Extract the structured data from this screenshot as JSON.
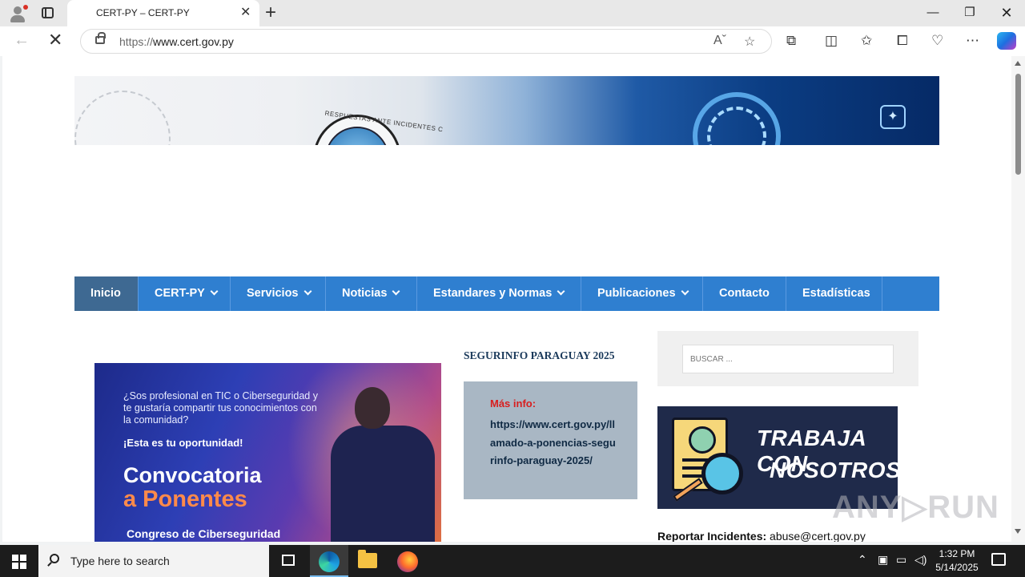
{
  "browser": {
    "tab_title": "CERT-PY – CERT-PY",
    "url_scheme": "https://",
    "url_host": "www.cert.gov.py",
    "tab_close_glyph": "✕",
    "new_tab_glyph": "+",
    "minimize_glyph": "—",
    "maximize_glyph": "❐",
    "close_glyph": "✕",
    "back_glyph": "←",
    "stop_glyph": "✕"
  },
  "site": {
    "banner_arc_text": "RESPUESTAS ANTE INCIDENTES C",
    "nav": [
      {
        "label": "Inicio",
        "active": true
      },
      {
        "label": "CERT-PY",
        "dropdown": true
      },
      {
        "label": "Servicios",
        "dropdown": true
      },
      {
        "label": "Noticias",
        "dropdown": true
      },
      {
        "label": "Estandares y Normas",
        "dropdown": true
      },
      {
        "label": "Publicaciones",
        "dropdown": true
      },
      {
        "label": "Contacto"
      },
      {
        "label": "Estadísticas"
      }
    ],
    "promo": {
      "question": "¿Sos profesional en TIC o Ciberseguridad y te gustaría compartir tus conocimientos con la comunidad?",
      "opportunity": "¡Esta es tu oportunidad!",
      "headline_1": "Convocatoria",
      "headline_2": "a Ponentes",
      "subtitle": "Congreso de Ciberseguridad"
    },
    "event_title": "SEGURINFO PARAGUAY 2025",
    "info_label": "Más info:",
    "info_link": "https://www.cert.gov.py/llamado-a-ponencias-segurinfo-paraguay-2025/",
    "search_placeholder": "BUSCAR ...",
    "job_banner_line1": "TRABAJA CON",
    "job_banner_line2": "NOSOTROS!",
    "report_label": "Reportar Incidentes:",
    "report_email": "abuse@cert.gov.py",
    "watermark": "ANY▷RUN"
  },
  "taskbar": {
    "search_placeholder": "Type here to search",
    "time": "1:32 PM",
    "date": "5/14/2025"
  }
}
